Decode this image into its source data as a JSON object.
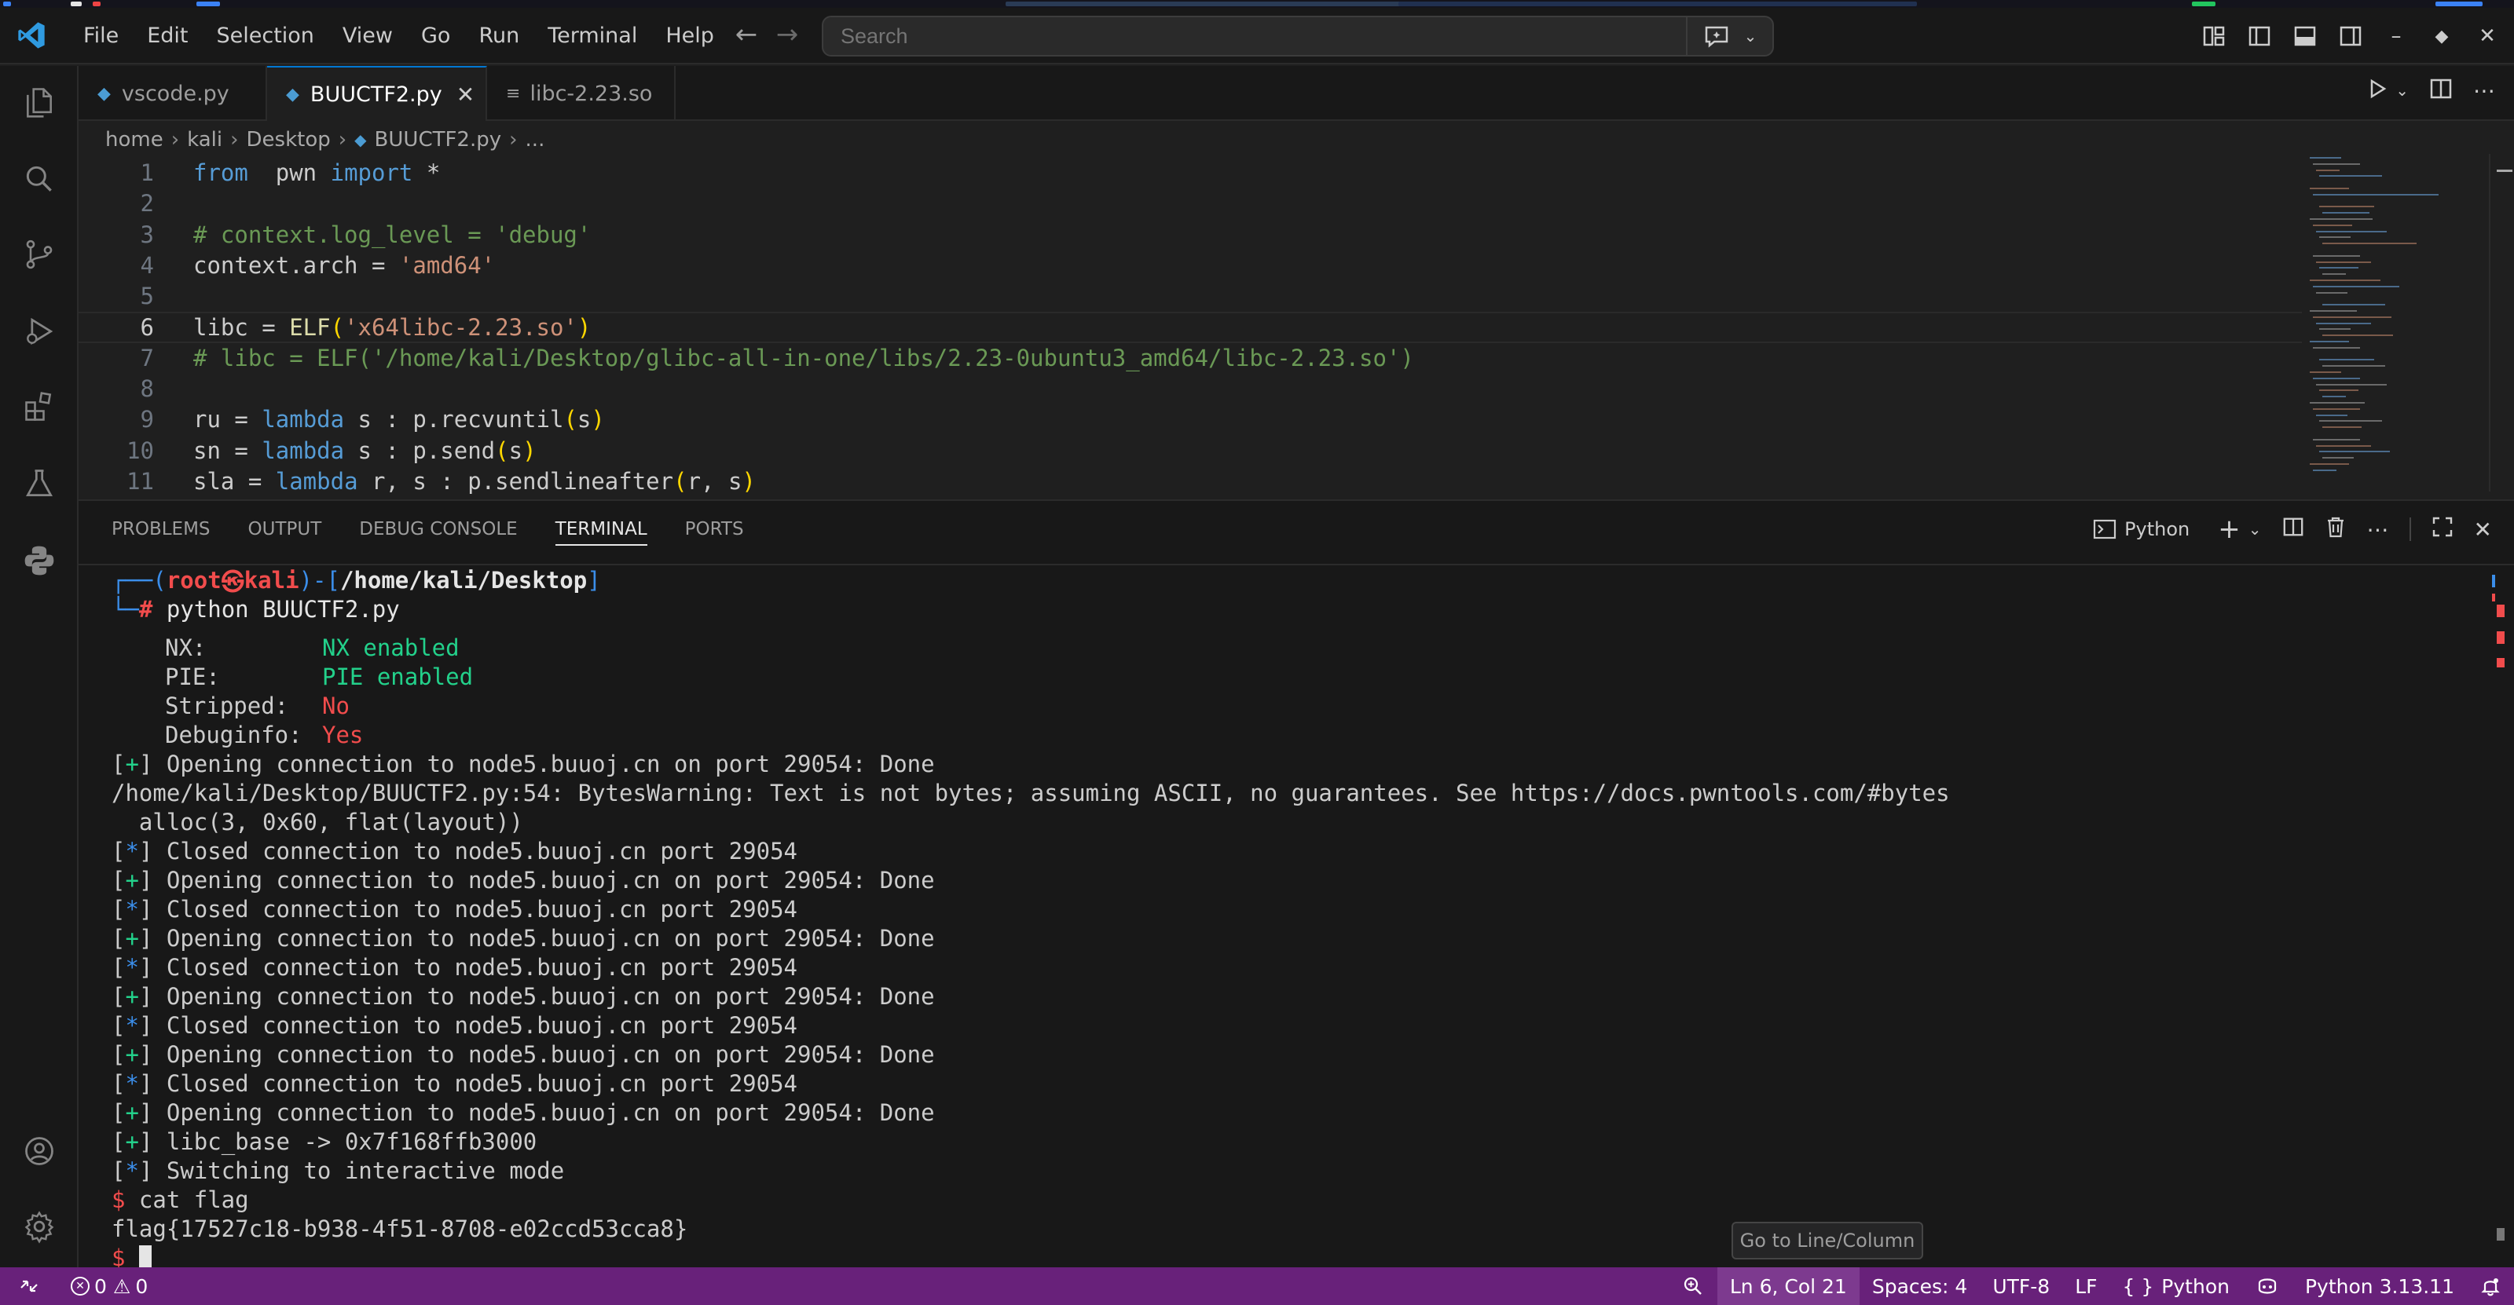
{
  "menu": [
    "File",
    "Edit",
    "Selection",
    "View",
    "Go",
    "Run",
    "Terminal",
    "Help"
  ],
  "search": {
    "placeholder": "Search"
  },
  "tabs": [
    {
      "label": "vscode.py",
      "icon": "python-icon"
    },
    {
      "label": "BUUCTF2.py",
      "icon": "python-icon",
      "active": true
    },
    {
      "label": "libc-2.23.so",
      "icon": "file-lines-icon"
    }
  ],
  "breadcrumb": [
    "home",
    "kali",
    "Desktop",
    "BUUCTF2.py",
    "..."
  ],
  "code_lines": [
    {
      "n": "1",
      "segs": [
        [
          "kw",
          "from"
        ],
        [
          "",
          "  pwn "
        ],
        [
          "kw",
          "import"
        ],
        [
          "",
          " *"
        ]
      ]
    },
    {
      "n": "2",
      "segs": []
    },
    {
      "n": "3",
      "segs": [
        [
          "cm",
          "# context.log_level = 'debug'"
        ]
      ]
    },
    {
      "n": "4",
      "segs": [
        [
          "",
          "context.arch = "
        ],
        [
          "str",
          "'amd64'"
        ]
      ]
    },
    {
      "n": "5",
      "segs": []
    },
    {
      "n": "6",
      "segs": [
        [
          "",
          "libc = "
        ],
        [
          "fn",
          "ELF"
        ],
        [
          "par",
          "("
        ],
        [
          "str",
          "'x64libc-2.23.so'"
        ],
        [
          "par",
          ")"
        ]
      ]
    },
    {
      "n": "7",
      "segs": [
        [
          "cm",
          "# libc = ELF('/home/kali/Desktop/glibc-all-in-one/libs/2.23-0ubuntu3_amd64/libc-2.23.so')"
        ]
      ]
    },
    {
      "n": "8",
      "segs": []
    },
    {
      "n": "9",
      "segs": [
        [
          "",
          "ru = "
        ],
        [
          "kw",
          "lambda"
        ],
        [
          "",
          " s : p.recvuntil"
        ],
        [
          "par",
          "("
        ],
        [
          "",
          "s"
        ],
        [
          "par",
          ")"
        ]
      ]
    },
    {
      "n": "10",
      "segs": [
        [
          "",
          "sn = "
        ],
        [
          "kw",
          "lambda"
        ],
        [
          "",
          " s : p.send"
        ],
        [
          "par",
          "("
        ],
        [
          "",
          "s"
        ],
        [
          "par",
          ")"
        ]
      ]
    },
    {
      "n": "11",
      "segs": [
        [
          "",
          "sla = "
        ],
        [
          "kw",
          "lambda"
        ],
        [
          "",
          " r, s : p.sendlineafter"
        ],
        [
          "par",
          "("
        ],
        [
          "",
          "r, s"
        ],
        [
          "par",
          ")"
        ]
      ]
    }
  ],
  "panel": {
    "tabs": [
      "PROBLEMS",
      "OUTPUT",
      "DEBUG CONSOLE",
      "TERMINAL",
      "PORTS"
    ],
    "active_tab": "TERMINAL",
    "shell_label": "Python"
  },
  "terminal": {
    "prompt_user": "root",
    "prompt_at": "㉿",
    "prompt_host": "kali",
    "prompt_path": "/home/kali/Desktop",
    "command": "python BUUCTF2.py",
    "checksec": [
      {
        "k": "NX:",
        "v": "NX enabled",
        "c": "g"
      },
      {
        "k": "PIE:",
        "v": "PIE enabled",
        "c": "g"
      },
      {
        "k": "Stripped:",
        "v": "No",
        "c": "r"
      },
      {
        "k": "Debuginfo:",
        "v": "Yes",
        "c": "r"
      }
    ],
    "lines": [
      {
        "tag": "+",
        "text": " Opening connection to node5.buuoj.cn on port 29054: Done"
      },
      {
        "tag": "",
        "text": "/home/kali/Desktop/BUUCTF2.py:54: BytesWarning: Text is not bytes; assuming ASCII, no guarantees. See https://docs.pwntools.com/#bytes"
      },
      {
        "tag": "",
        "text": "  alloc(3, 0x60, flat(layout))"
      },
      {
        "tag": "*",
        "text": " Closed connection to node5.buuoj.cn port 29054"
      },
      {
        "tag": "+",
        "text": " Opening connection to node5.buuoj.cn on port 29054: Done"
      },
      {
        "tag": "*",
        "text": " Closed connection to node5.buuoj.cn port 29054"
      },
      {
        "tag": "+",
        "text": " Opening connection to node5.buuoj.cn on port 29054: Done"
      },
      {
        "tag": "*",
        "text": " Closed connection to node5.buuoj.cn port 29054"
      },
      {
        "tag": "+",
        "text": " Opening connection to node5.buuoj.cn on port 29054: Done"
      },
      {
        "tag": "*",
        "text": " Closed connection to node5.buuoj.cn port 29054"
      },
      {
        "tag": "+",
        "text": " Opening connection to node5.buuoj.cn on port 29054: Done"
      },
      {
        "tag": "*",
        "text": " Closed connection to node5.buuoj.cn port 29054"
      },
      {
        "tag": "+",
        "text": " Opening connection to node5.buuoj.cn on port 29054: Done"
      },
      {
        "tag": "+",
        "text": " libc_base -> 0x7f168ffb3000"
      },
      {
        "tag": "*",
        "text": " Switching to interactive mode"
      }
    ],
    "cat_cmd": " cat flag",
    "flag": "flag{17527c18-b938-4f51-8708-e02ccd53cca8}",
    "dollar": "$"
  },
  "tooltip": "Go to Line/Column",
  "status": {
    "errors": "0",
    "warnings": "0",
    "position": "Ln 6, Col 21",
    "spaces": "Spaces: 4",
    "encoding": "UTF-8",
    "eol": "LF",
    "language": "Python",
    "interpreter": "Python 3.13.11"
  },
  "colors": {
    "accent": "#0078d4",
    "statusbar": "#68217a",
    "green": "#23d18b",
    "red": "#f14c4c",
    "blue": "#3b8eea"
  }
}
